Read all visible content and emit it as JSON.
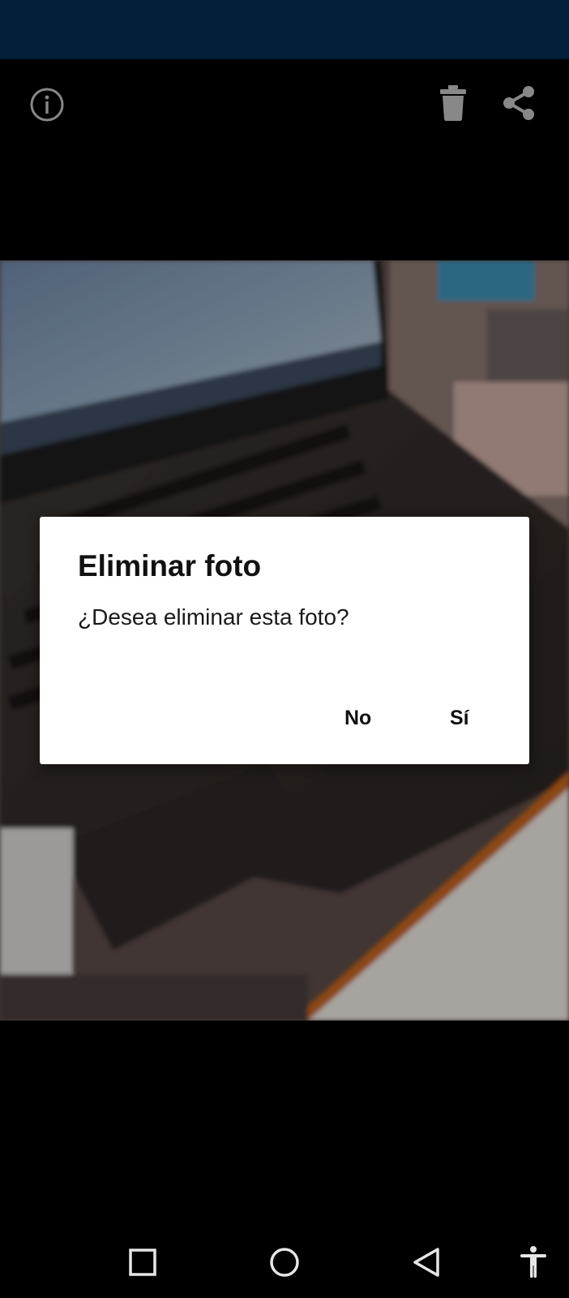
{
  "top_bar": {
    "info_icon": "info-icon",
    "delete_icon": "trash-icon",
    "share_icon": "share-icon"
  },
  "dialog": {
    "title": "Eliminar foto",
    "message": "¿Desea eliminar esta foto?",
    "no_label": "No",
    "yes_label": "Sí"
  },
  "nav_bar": {
    "recents_icon": "square-icon",
    "home_icon": "circle-icon",
    "back_icon": "triangle-back-icon",
    "accessibility_icon": "accessibility-icon"
  },
  "colors": {
    "status_bar": "#032a4e",
    "background": "#000000",
    "dialog_bg": "#ffffff"
  }
}
